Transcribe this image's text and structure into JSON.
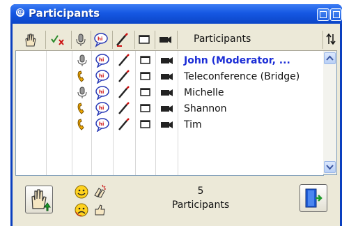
{
  "window": {
    "title": "Participants"
  },
  "header": {
    "participants_label": "Participants"
  },
  "participants": [
    {
      "name": "John (Moderator, ...",
      "moderator": true,
      "audio": "mic"
    },
    {
      "name": "Teleconference (Bridge)",
      "moderator": false,
      "audio": "phone"
    },
    {
      "name": "Michelle",
      "moderator": false,
      "audio": "mic"
    },
    {
      "name": "Shannon",
      "moderator": false,
      "audio": "phone"
    },
    {
      "name": "Tim",
      "moderator": false,
      "audio": "phone"
    }
  ],
  "footer": {
    "count": "5",
    "count_label": "Participants"
  },
  "colors": {
    "title_bar": "#1658e3",
    "moderator_text": "#1b2dd6",
    "panel": "#ece9d8"
  }
}
